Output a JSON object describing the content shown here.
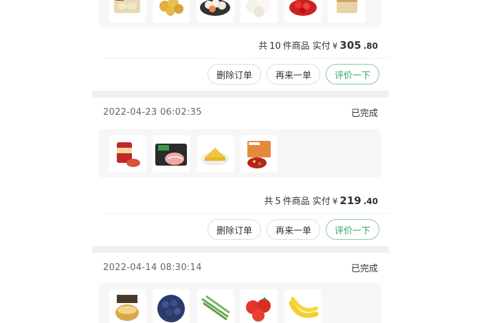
{
  "orders": [
    {
      "time": "",
      "status": "",
      "summary_prefix": "共",
      "count": "10",
      "summary_mid": "件商品 实付",
      "currency": "¥",
      "price_int": "305",
      "price_dec": ".80",
      "products": [
        "dumpling-box",
        "fried-balls",
        "fish-balls",
        "steamed-buns",
        "crayfish",
        "dessert-cake"
      ]
    },
    {
      "time": "2022-04-23 06:02:35",
      "status": "已完成",
      "summary_prefix": "共",
      "count": "5",
      "summary_mid": "件商品 实付",
      "currency": "¥",
      "price_int": "219",
      "price_dec": ".40",
      "products": [
        "sauce-jar",
        "sliced-beef",
        "egg-cake",
        "spicy-soup-base"
      ]
    },
    {
      "time": "2022-04-14 08:30:14",
      "status": "已完成",
      "products": [
        "dessert-cup",
        "blueberries",
        "asparagus",
        "tomatoes",
        "bananas"
      ]
    }
  ],
  "actions": {
    "delete": "删除订单",
    "reorder": "再来一单",
    "review": "评价一下"
  },
  "colors": {
    "accent_green": "#2fa35a",
    "separator": "#f0f0f0",
    "strip_bg": "#f6f6f6"
  }
}
